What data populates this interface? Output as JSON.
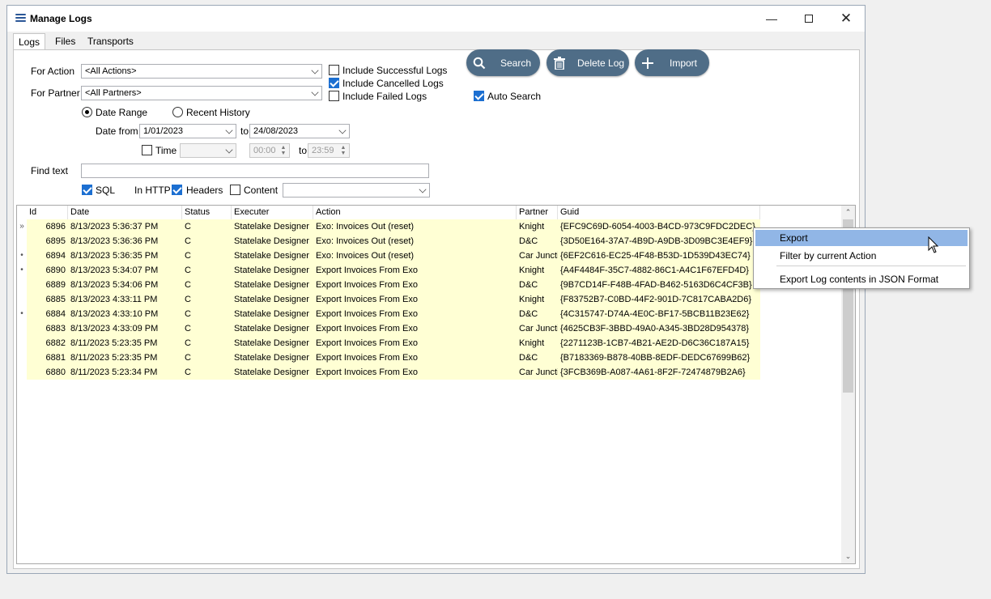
{
  "window": {
    "title": "Manage Logs"
  },
  "tabs": [
    "Logs",
    "Files",
    "Transports"
  ],
  "filters": {
    "for_action_label": "For Action",
    "for_action_value": "<All Actions>",
    "for_partner_label": "For Partner",
    "for_partner_value": "<All Partners>",
    "include_successful": "Include Successful Logs",
    "include_cancelled": "Include Cancelled Logs",
    "include_failed": "Include Failed Logs",
    "date_range": "Date Range",
    "recent_history": "Recent History",
    "date_from_label": "Date from",
    "date_from": "1/01/2023",
    "to_label": "to",
    "date_to": "24/08/2023",
    "time_label": "Time",
    "time_from": "00:00",
    "time_to": "23:59",
    "find_text_label": "Find text",
    "sql_label": "SQL",
    "in_http_label": "In HTTP",
    "headers_label": "Headers",
    "content_label": "Content"
  },
  "buttons": {
    "search": "Search",
    "delete_log": "Delete Log",
    "import": "Import",
    "auto_search": "Auto Search"
  },
  "grid": {
    "columns": [
      "Id",
      "Date",
      "Status",
      "Executer",
      "Action",
      "Partner",
      "Guid"
    ],
    "rows": [
      {
        "ind": "»",
        "id": "6896",
        "date": "8/13/2023 5:36:37 PM",
        "status": "C",
        "executer": "Statelake Designer",
        "action": "Exo: Invoices Out (reset)",
        "partner": "Knight",
        "guid": "{EFC9C69D-6054-4003-B4CD-973C9FDC2DEC}"
      },
      {
        "ind": "",
        "id": "6895",
        "date": "8/13/2023 5:36:36 PM",
        "status": "C",
        "executer": "Statelake Designer",
        "action": "Exo: Invoices Out (reset)",
        "partner": "D&C",
        "guid": "{3D50E164-37A7-4B9D-A9DB-3D09BC3E4EF9}"
      },
      {
        "ind": "•",
        "id": "6894",
        "date": "8/13/2023 5:36:35 PM",
        "status": "C",
        "executer": "Statelake Designer",
        "action": "Exo: Invoices Out (reset)",
        "partner": "Car Juncti",
        "guid": "{6EF2C616-EC25-4F48-B53D-1D539D43EC74}"
      },
      {
        "ind": "•",
        "id": "6890",
        "date": "8/13/2023 5:34:07 PM",
        "status": "C",
        "executer": "Statelake Designer",
        "action": "Export Invoices From Exo",
        "partner": "Knight",
        "guid": "{A4F4484F-35C7-4882-86C1-A4C1F67EFD4D}"
      },
      {
        "ind": "",
        "id": "6889",
        "date": "8/13/2023 5:34:06 PM",
        "status": "C",
        "executer": "Statelake Designer",
        "action": "Export Invoices From Exo",
        "partner": "D&C",
        "guid": "{9B7CD14F-F48B-4FAD-B462-5163D6C4CF3B}"
      },
      {
        "ind": "",
        "id": "6885",
        "date": "8/13/2023 4:33:11 PM",
        "status": "C",
        "executer": "Statelake Designer",
        "action": "Export Invoices From Exo",
        "partner": "Knight",
        "guid": "{F83752B7-C0BD-44F2-901D-7C817CABA2D6}"
      },
      {
        "ind": "•",
        "id": "6884",
        "date": "8/13/2023 4:33:10 PM",
        "status": "C",
        "executer": "Statelake Designer",
        "action": "Export Invoices From Exo",
        "partner": "D&C",
        "guid": "{4C315747-D74A-4E0C-BF17-5BCB11B23E62}"
      },
      {
        "ind": "",
        "id": "6883",
        "date": "8/13/2023 4:33:09 PM",
        "status": "C",
        "executer": "Statelake Designer",
        "action": "Export Invoices From Exo",
        "partner": "Car Juncti",
        "guid": "{4625CB3F-3BBD-49A0-A345-3BD28D954378}"
      },
      {
        "ind": "",
        "id": "6882",
        "date": "8/11/2023 5:23:35 PM",
        "status": "C",
        "executer": "Statelake Designer",
        "action": "Export Invoices From Exo",
        "partner": "Knight",
        "guid": "{2271123B-1CB7-4B21-AE2D-D6C36C187A15}"
      },
      {
        "ind": "",
        "id": "6881",
        "date": "8/11/2023 5:23:35 PM",
        "status": "C",
        "executer": "Statelake Designer",
        "action": "Export Invoices From Exo",
        "partner": "D&C",
        "guid": "{B7183369-B878-40BB-8EDF-DEDC67699B62}"
      },
      {
        "ind": "",
        "id": "6880",
        "date": "8/11/2023 5:23:34 PM",
        "status": "C",
        "executer": "Statelake Designer",
        "action": "Export Invoices From Exo",
        "partner": "Car Juncti",
        "guid": "{3FCB369B-A087-4A61-8F2F-72474879B2A6}"
      }
    ]
  },
  "context_menu": [
    "Export",
    "Filter by current Action",
    "Export Log contents in JSON Format"
  ],
  "colors": {
    "row_bg": "#ffffd4",
    "pill_bg": "#4f6d87",
    "menu_highlight": "#91b6e6",
    "checkbox_on": "#1c6fd1"
  }
}
